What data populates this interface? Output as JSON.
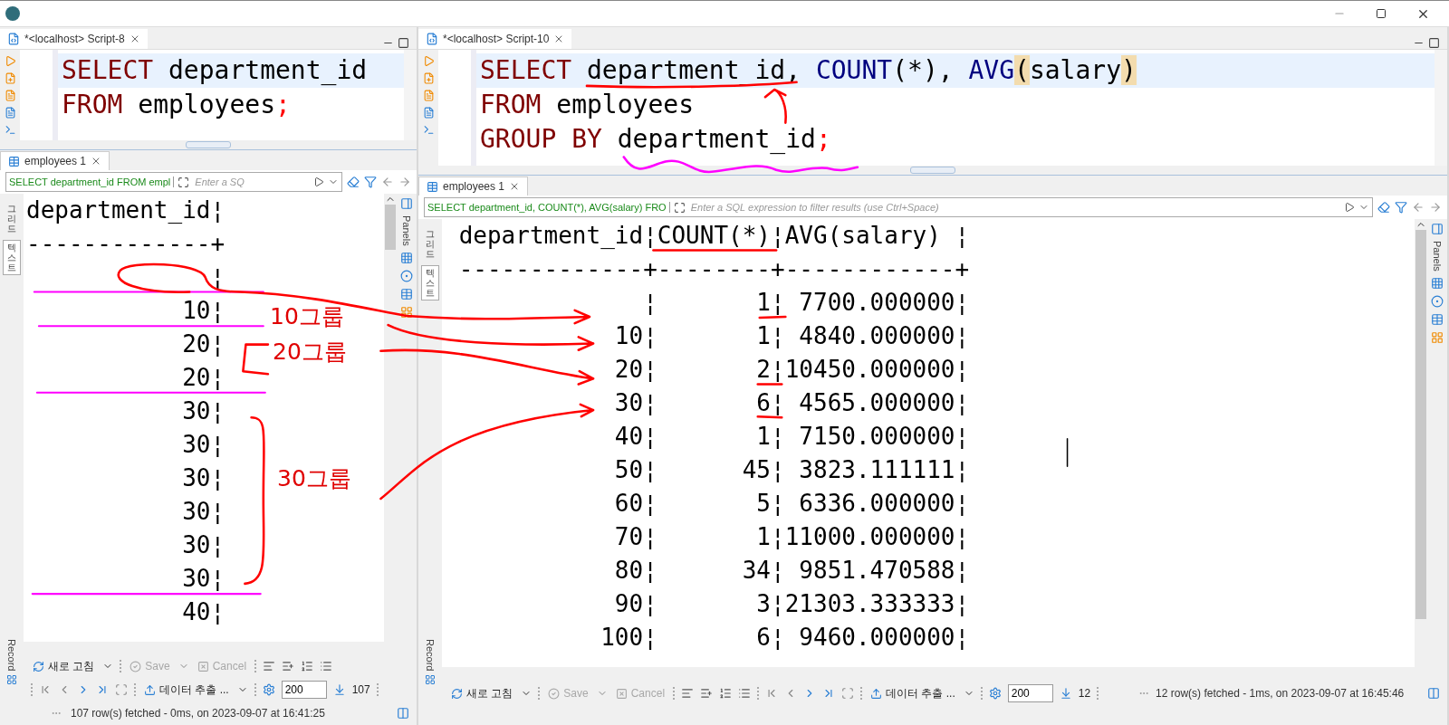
{
  "panes": [
    {
      "editor": {
        "tab": "*<localhost> Script-8",
        "lines": [
          {
            "highlighted": true,
            "tokens": [
              {
                "kind": "keyword",
                "text": "SELECT"
              },
              {
                "kind": "plain",
                "text": " department_id"
              }
            ]
          },
          {
            "highlighted": false,
            "tokens": [
              {
                "kind": "keyword",
                "text": "FROM"
              },
              {
                "kind": "plain",
                "text": " employees"
              },
              {
                "kind": "punct",
                "text": ";"
              }
            ]
          }
        ]
      },
      "results": {
        "tab": "employees 1",
        "query": "SELECT department_id FROM empl",
        "filter_placeholder": "Enter a SQ",
        "view_tabs": [
          {
            "label": "그리드",
            "selected": false
          },
          {
            "label": "텍스트",
            "selected": true
          }
        ],
        "record": "Record",
        "panels": "Panels",
        "lines": [
          "department_id¦",
          "-------------+",
          "¦",
          "10¦",
          "20¦",
          "20¦",
          "30¦",
          "30¦",
          "30¦",
          "30¦",
          "30¦",
          "30¦",
          "40¦"
        ]
      },
      "toolbar": {
        "refresh": "새로 고침",
        "buttons": [
          {
            "label": "Save",
            "disabled": true
          },
          {
            "label": "Cancel",
            "disabled": true
          }
        ],
        "export": "데이터 추출 ...",
        "fetch_size": "200",
        "row_count": "107",
        "status": "107 row(s) fetched - 0ms, on 2023-09-07 at 16:41:25"
      }
    },
    {
      "editor": {
        "tab": "*<localhost> Script-10",
        "lines": [
          {
            "highlighted": true,
            "tokens": [
              {
                "kind": "keyword",
                "text": "SELECT"
              },
              {
                "kind": "plain",
                "text": " department_id, "
              },
              {
                "kind": "function",
                "text": "COUNT"
              },
              {
                "kind": "plain",
                "text": "(*), "
              },
              {
                "kind": "function",
                "text": "AVG"
              },
              {
                "kind": "bracket",
                "text": "("
              },
              {
                "kind": "plain",
                "text": "salary"
              },
              {
                "kind": "bracket",
                "text": ")"
              }
            ]
          },
          {
            "highlighted": false,
            "tokens": [
              {
                "kind": "keyword",
                "text": "FROM"
              },
              {
                "kind": "plain",
                "text": " employees"
              }
            ]
          },
          {
            "highlighted": false,
            "tokens": [
              {
                "kind": "keyword",
                "text": "GROUP BY"
              },
              {
                "kind": "plain",
                "text": " department_id"
              },
              {
                "kind": "punct",
                "text": ";"
              }
            ]
          }
        ]
      },
      "results": {
        "tab": "employees 1",
        "query": "SELECT department_id, COUNT(*), AVG(salary) FRO",
        "filter_placeholder": "Enter a SQL expression to filter results (use Ctrl+Space)",
        "view_tabs": [
          {
            "label": "그리드",
            "selected": false
          },
          {
            "label": "텍스트",
            "selected": true
          }
        ],
        "record": "Record",
        "panels": "Panels",
        "lines": [
          "department_id¦COUNT(*)¦AVG(salary) ¦",
          "-------------+--------+------------+",
          "¦       1¦ 7700.000000¦",
          "10¦       1¦ 4840.000000¦",
          "20¦       2¦10450.000000¦",
          "30¦       6¦ 4565.000000¦",
          "40¦       1¦ 7150.000000¦",
          "50¦      45¦ 3823.111111¦",
          "60¦       5¦ 6336.000000¦",
          "70¦       1¦11000.000000¦",
          "80¦      34¦ 9851.470588¦",
          "90¦       3¦21303.333333¦",
          "100¦       6¦ 9460.000000¦"
        ]
      },
      "toolbar": {
        "refresh": "새로 고침",
        "buttons": [
          {
            "label": "Save",
            "disabled": true
          },
          {
            "label": "Cancel",
            "disabled": true
          }
        ],
        "export": "데이터 추출 ...",
        "fetch_size": "200",
        "row_count": "12",
        "status": "12 row(s) fetched - 1ms, on 2023-09-07 at 16:45:46"
      }
    }
  ],
  "annotations": [
    {
      "text": "10그룹"
    },
    {
      "text": "20그룹"
    },
    {
      "text": "30그룹"
    }
  ]
}
